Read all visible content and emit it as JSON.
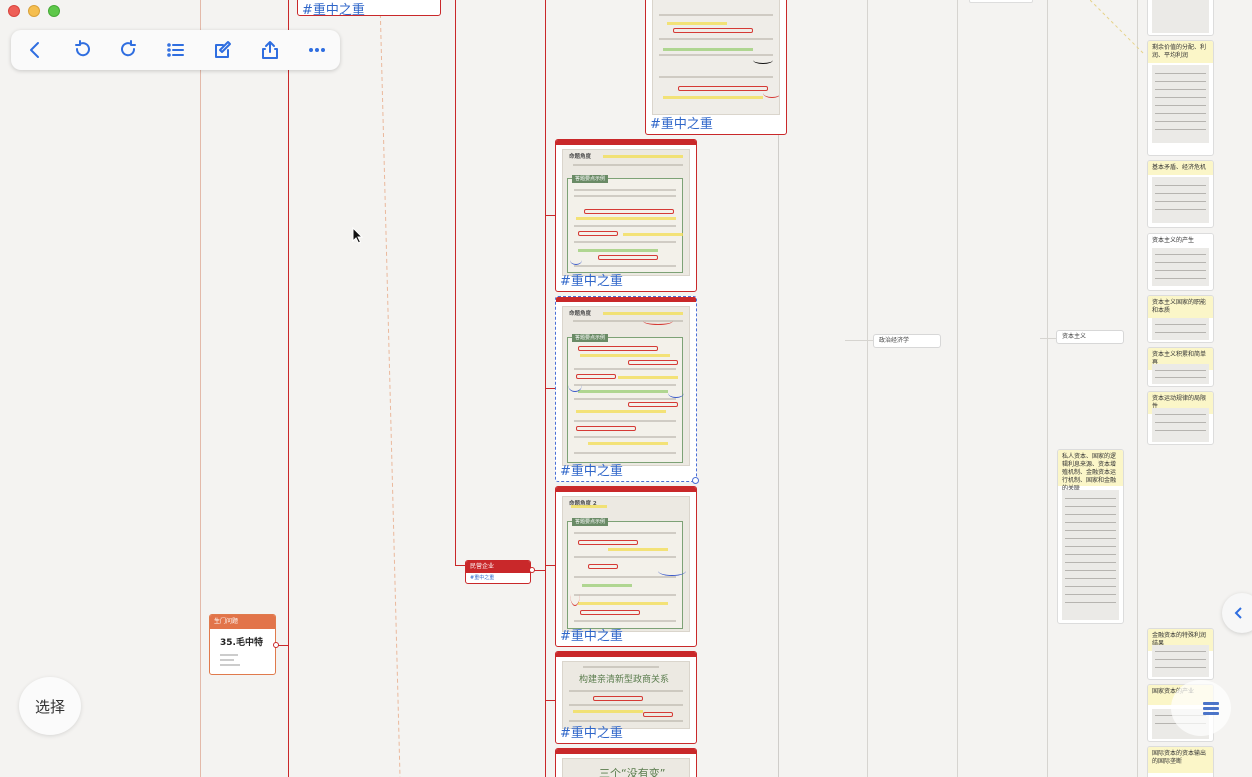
{
  "toolbar": {
    "back": "back-icon",
    "undo": "undo-icon",
    "redo": "redo-icon",
    "outline": "list-icon",
    "edit": "edit-icon",
    "share": "share-icon",
    "more": "more-icon"
  },
  "tag_label": "#重中之重",
  "cards": {
    "c1": {
      "heading": "命题角度 ",
      "intro_box": "答题要点示例"
    },
    "c2": {
      "heading": "命题角度 ",
      "intro_box": "答题要点示例"
    },
    "c3": {
      "heading": "命题角度 2",
      "intro_box": "答题要点示例"
    },
    "c4": {
      "heading": "构建亲清新型政商关系"
    },
    "c5": {
      "heading": "三个“没有变”"
    }
  },
  "top_node": {
    "label": "#重中之重"
  },
  "sub_node": {
    "title": "民营企业",
    "tag": "#重中之重"
  },
  "left_node": {
    "head": "生门问题",
    "title": "35.毛中特"
  },
  "middle_node": {
    "label": "政治经济学"
  },
  "right_node": {
    "label": "资本主义"
  },
  "right_cards": [
    {
      "title": "剩余价值的分配、利润、平均利润"
    },
    {
      "title": "基本矛盾、经济危机"
    },
    {
      "title": "资本主义的产生"
    },
    {
      "title": "资本主义国家的职能和本质"
    },
    {
      "title": "资本主义积累和简单再"
    },
    {
      "title": "资本运动规律的局限性"
    }
  ],
  "right_tall_card": {
    "title": "私人资本、国家的逻辑利息来源、资本增殖机制、金融资本运行机制、国家和金融的关联"
  },
  "right_lower_cards": [
    {
      "title": "金融资本的特殊利润结果"
    },
    {
      "title": "国家资本的产业"
    },
    {
      "title": "国际资本的资本输出的国际垄断"
    }
  ],
  "select_button": "选择",
  "colors": {
    "accent_red": "#c9282a",
    "link_blue": "#2f66c9",
    "toolbar_blue": "#2f6ee0"
  }
}
